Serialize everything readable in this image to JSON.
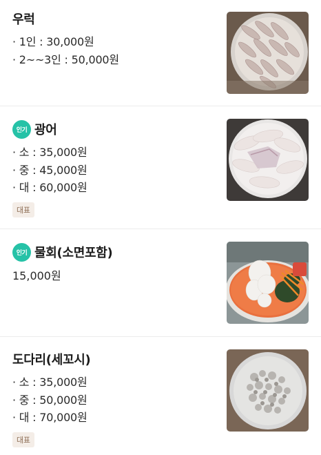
{
  "menu": [
    {
      "name": "우럭",
      "popular": false,
      "prices": [
        "· 1인 : 30,000원",
        "· 2~~3인 : 50,000원"
      ],
      "representative": false,
      "image": "sliced-rockfish-sashimi-photo"
    },
    {
      "name": "광어",
      "popular": true,
      "popular_label": "인기",
      "prices": [
        "· 소 : 35,000원",
        "· 중 : 45,000원",
        "· 대 : 60,000원"
      ],
      "representative": true,
      "representative_label": "대표",
      "image": "flatfish-sashimi-photo"
    },
    {
      "name": "물회(소면포함)",
      "popular": true,
      "popular_label": "인기",
      "price": "15,000원",
      "representative": false,
      "image": "cold-raw-fish-soup-photo"
    },
    {
      "name": "도다리(세꼬시)",
      "popular": false,
      "prices": [
        "· 소 : 35,000원",
        "· 중 : 50,000원",
        "· 대 : 70,000원"
      ],
      "representative": true,
      "representative_label": "대표",
      "image": "flounder-bone-in-sashimi-photo"
    }
  ]
}
